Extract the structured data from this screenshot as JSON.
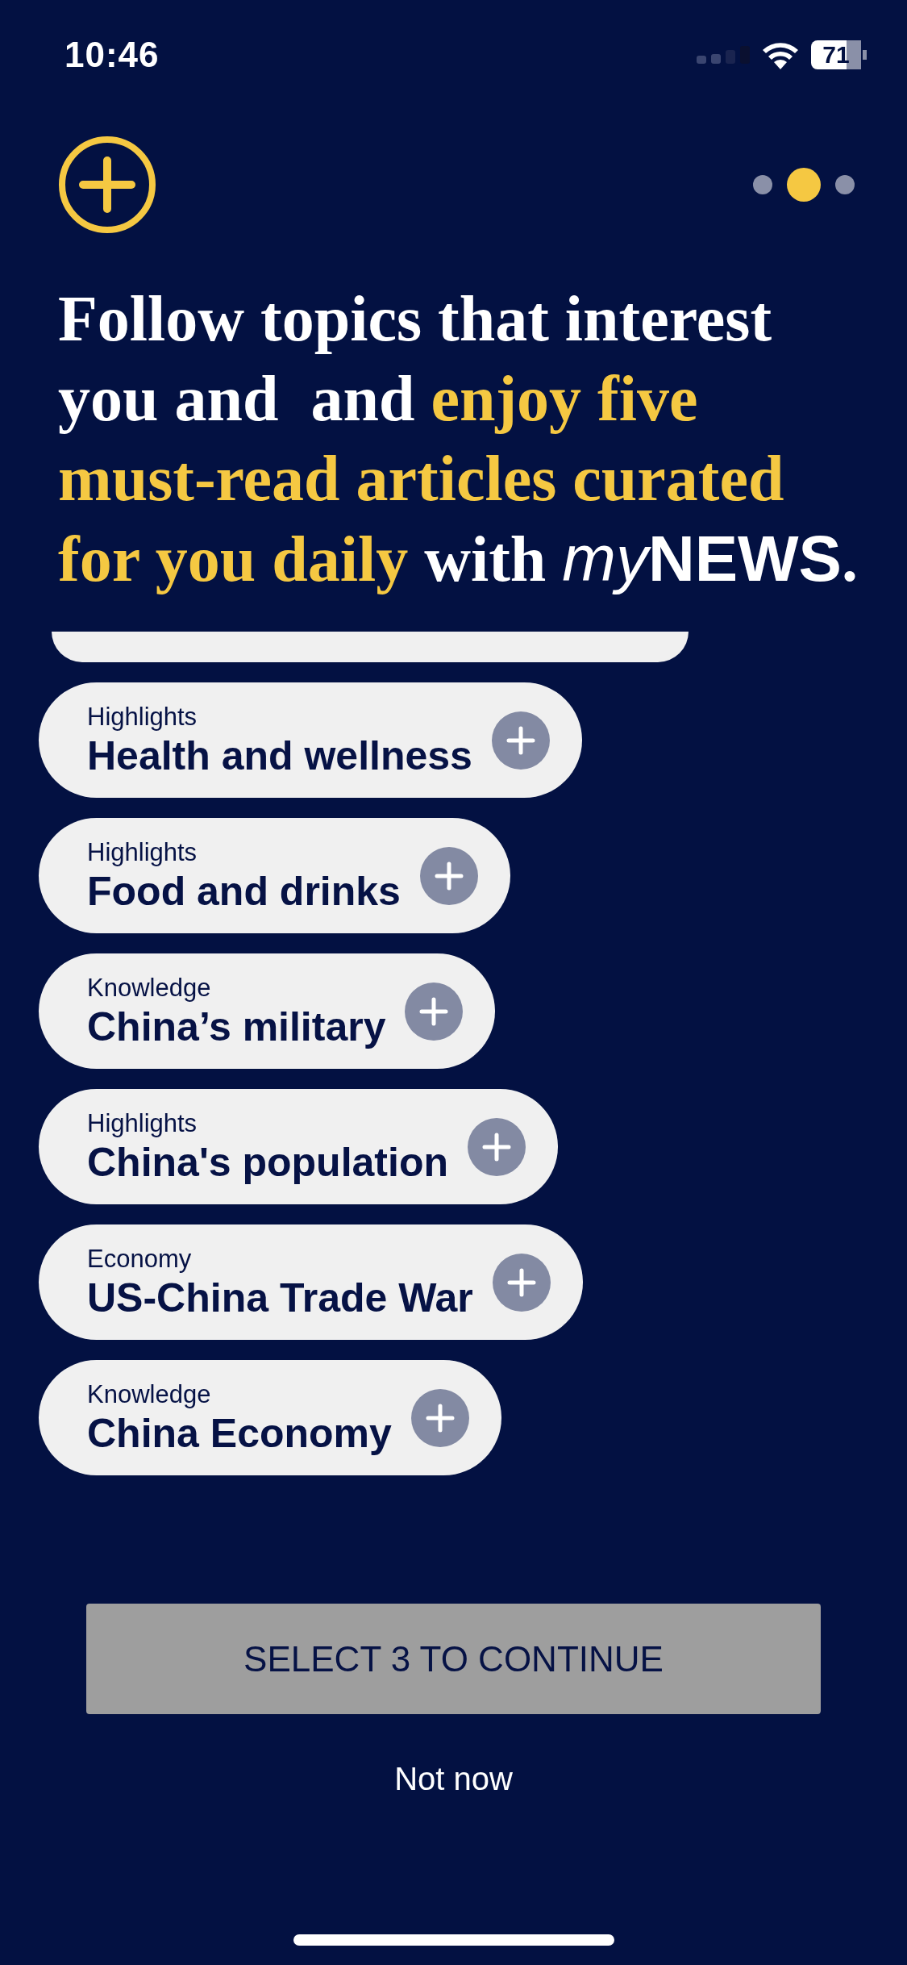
{
  "status_bar": {
    "time": "10:46",
    "battery": "71"
  },
  "pager": [
    {
      "selected": false
    },
    {
      "selected": true
    },
    {
      "selected": false
    }
  ],
  "headline": [
    {
      "text": "Follow topics that interest you and  and ",
      "kind": "plain"
    },
    {
      "text": "enjoy five must-read articles curated for you daily",
      "kind": "accent"
    },
    {
      "text": " with ",
      "kind": "plain"
    },
    {
      "text": "my",
      "kind": "italic"
    },
    {
      "text": "NEWS",
      "kind": "brand"
    },
    {
      "text": ".",
      "kind": "plain"
    }
  ],
  "topics": [
    {
      "kind": "cut"
    },
    {
      "kind": "pill",
      "category": "Highlights",
      "title": "Health and wellness"
    },
    {
      "kind": "pill",
      "category": "Highlights",
      "title": "Food and drinks"
    },
    {
      "kind": "pill",
      "category": "Knowledge",
      "title": "China’s military"
    },
    {
      "kind": "pill",
      "category": "Highlights",
      "title": "China's population"
    },
    {
      "kind": "pill",
      "category": "Economy",
      "title": "US-China Trade War"
    },
    {
      "kind": "pill",
      "category": "Knowledge",
      "title": "China Economy"
    }
  ],
  "continue_button": {
    "label": "SELECT 3 TO CONTINUE",
    "disabled": true
  },
  "skip_link": "Not now"
}
